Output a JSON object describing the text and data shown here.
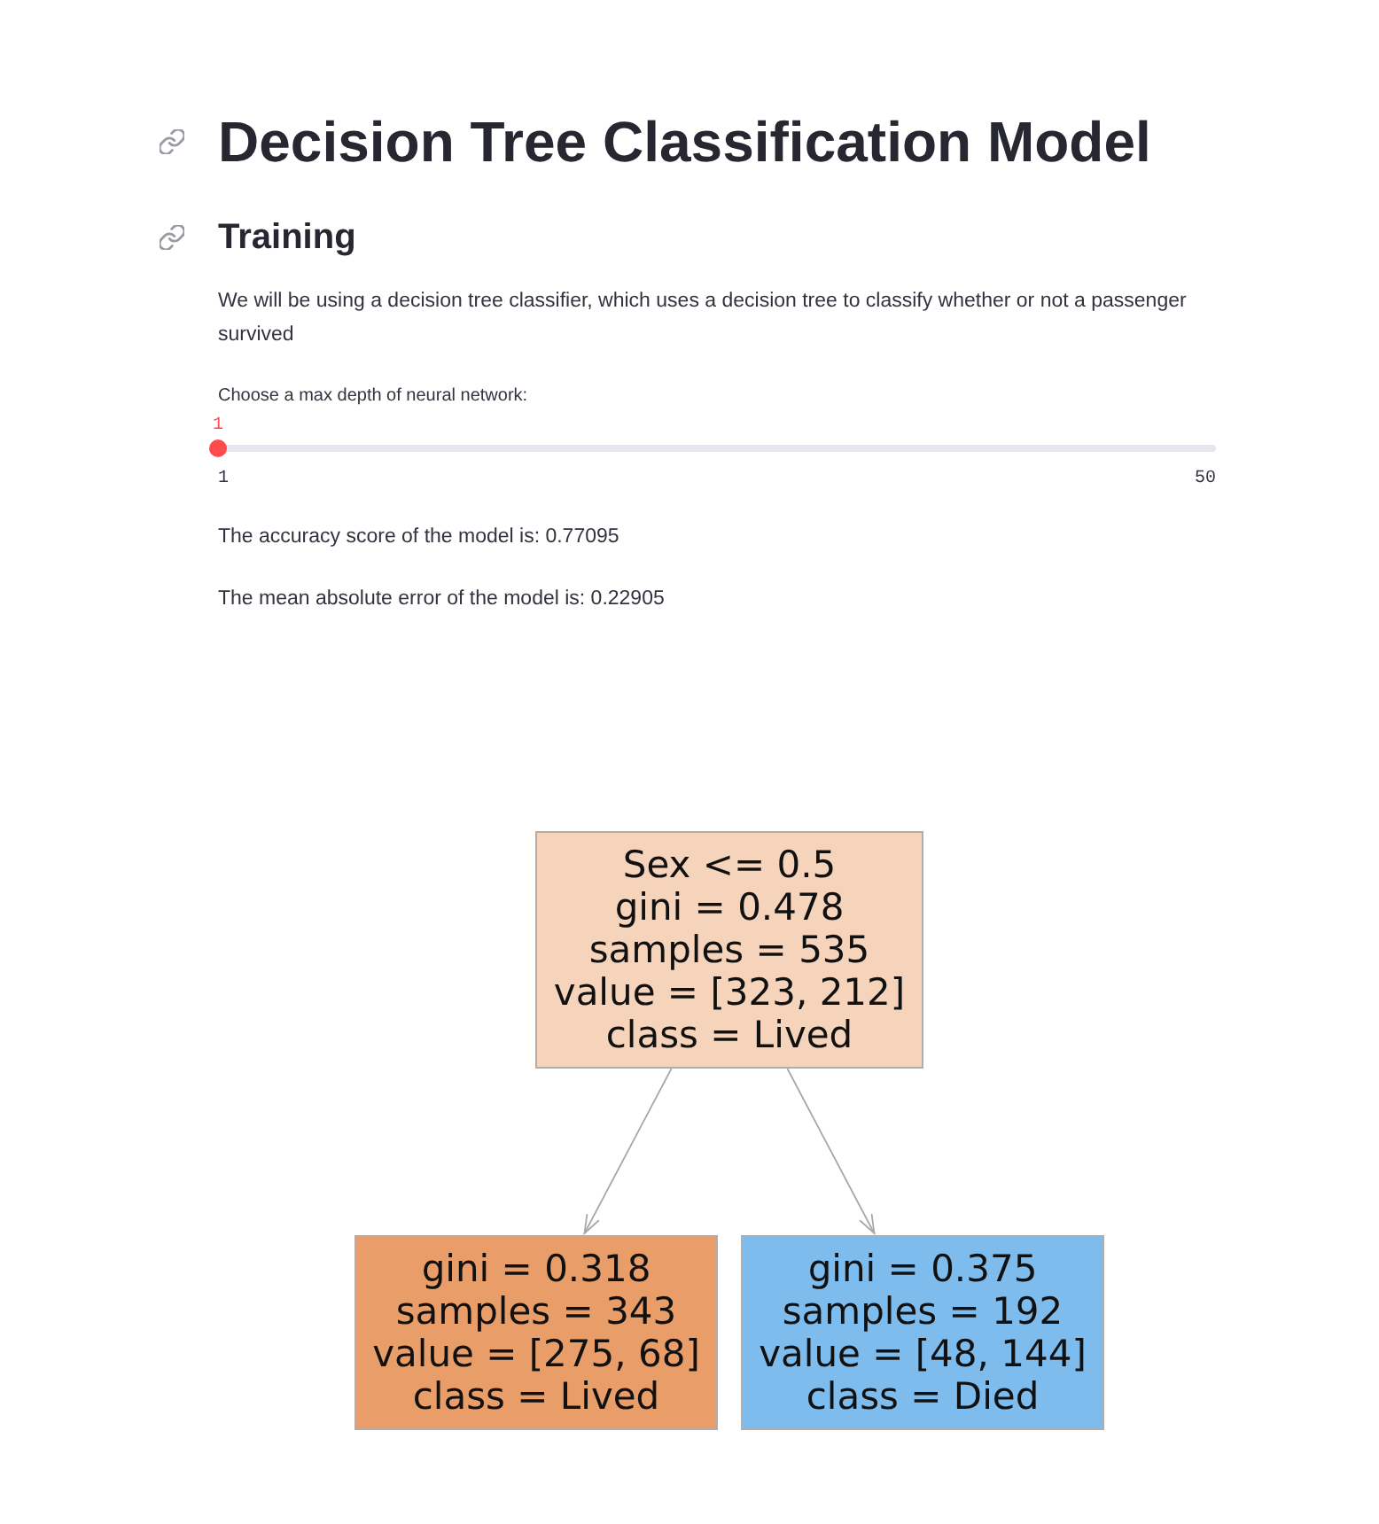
{
  "page": {
    "title": "Decision Tree Classification Model",
    "heading": "Training",
    "description": "We will be using a decision tree classifier, which uses a decision tree to classify whether or not a passenger survived"
  },
  "slider": {
    "label": "Choose a max depth of neural network:",
    "value": "1",
    "min": "1",
    "max": "50",
    "level": 0
  },
  "results": [
    "The accuracy score of the model is: 0.77095",
    "The mean absolute error of the model is: 0.22905"
  ],
  "tree": {
    "root": {
      "color": "#f6d4bb",
      "lines": [
        "Sex <= 0.5",
        "gini = 0.478",
        "samples = 535",
        "value = [323, 212]",
        "class = Lived"
      ],
      "children": [
        {
          "color": "#e99e69",
          "lines": [
            "gini = 0.318",
            "samples = 343",
            "value = [275, 68]",
            "class = Lived"
          ]
        },
        {
          "color": "#7fbcee",
          "lines": [
            "gini = 0.375",
            "samples = 192",
            "value = [48, 144]",
            "class = Died"
          ]
        }
      ]
    }
  }
}
